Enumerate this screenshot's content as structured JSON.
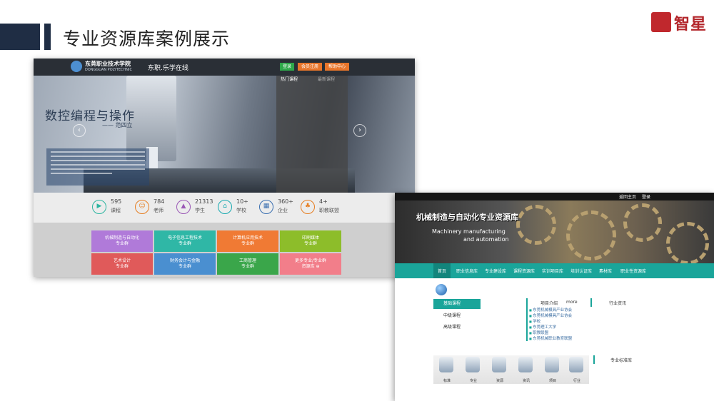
{
  "slide": {
    "title": "专业资源库案例展示",
    "logo_text": "智星"
  },
  "site1": {
    "school_cn": "东莞职业技术学院",
    "school_en": "DONGGUAN POLYTECHNIC",
    "site_name": "东职.乐学在线",
    "top_buttons": [
      "登录",
      "会员注册",
      "帮助中心"
    ],
    "panel_tabs": [
      "热门课程",
      "最新课程"
    ],
    "hero_title": "数控编程与操作",
    "hero_author": "—— 范四立",
    "stats": [
      {
        "num": "595",
        "label": "课程",
        "icon": "video-icon",
        "color": "#2bb5a0"
      },
      {
        "num": "784",
        "label": "老师",
        "icon": "teacher-icon",
        "color": "#e67e22"
      },
      {
        "num": "21313",
        "label": "学生",
        "icon": "graduation-cap-icon",
        "color": "#9b59b6"
      },
      {
        "num": "10+",
        "label": "学校",
        "icon": "school-icon",
        "color": "#16a9b0"
      },
      {
        "num": "360+",
        "label": "企业",
        "icon": "company-icon",
        "color": "#3a6fb0"
      },
      {
        "num": "4+",
        "label": "职教联盟",
        "icon": "alliance-icon",
        "color": "#e67e22"
      }
    ],
    "tiles": [
      {
        "line1": "机械制造与自动化",
        "line2": "专业群",
        "color": "#b07ad9"
      },
      {
        "line1": "电子信息工程技术",
        "line2": "专业群",
        "color": "#2fb7a6"
      },
      {
        "line1": "计算机应用技术",
        "line2": "专业群",
        "color": "#f07a34"
      },
      {
        "line1": "印刷媒体",
        "line2": "专业群",
        "color": "#8dbd2a"
      },
      {
        "line1": "艺术设计",
        "line2": "专业群",
        "color": "#e05a5a"
      },
      {
        "line1": "财务会计与金融",
        "line2": "专业群",
        "color": "#4a8fd0"
      },
      {
        "line1": "工商管理",
        "line2": "专业群",
        "color": "#3aa64a"
      },
      {
        "line1": "更多专业/专业群",
        "line2": "资源库 ⊕",
        "color": "#f27e8a"
      }
    ]
  },
  "site2": {
    "top_links": [
      "返回主页",
      "登录"
    ],
    "banner_title": "机械制造与自动化专业资源库",
    "banner_sub1": "Machinery manufacturing",
    "banner_sub2": "and automation",
    "nav": [
      "首页",
      "职业信息库",
      "专业建设库",
      "课程资源库",
      "实训项目库",
      "培训认证库",
      "素材库",
      "职业性资源库"
    ],
    "side": [
      "基础课程",
      "中级课程",
      "高级课程"
    ],
    "col_headers": {
      "intro": "项目介绍",
      "more": "more",
      "news": "行业资讯",
      "standards": "专业标准库"
    },
    "list": [
      "东莞机械模具产业协会",
      "东莞机械模具产业协会",
      "学校",
      "东莞理工大学",
      "职教联盟",
      "东莞机械职业教育联盟"
    ],
    "icons": [
      {
        "label": "标准",
        "icon": "standard-icon"
      },
      {
        "label": "专业",
        "icon": "major-icon"
      },
      {
        "label": "资源",
        "icon": "resource-icon"
      },
      {
        "label": "资讯",
        "icon": "news-icon"
      },
      {
        "label": "项目",
        "icon": "project-icon"
      },
      {
        "label": "行业",
        "icon": "industry-icon"
      }
    ]
  }
}
